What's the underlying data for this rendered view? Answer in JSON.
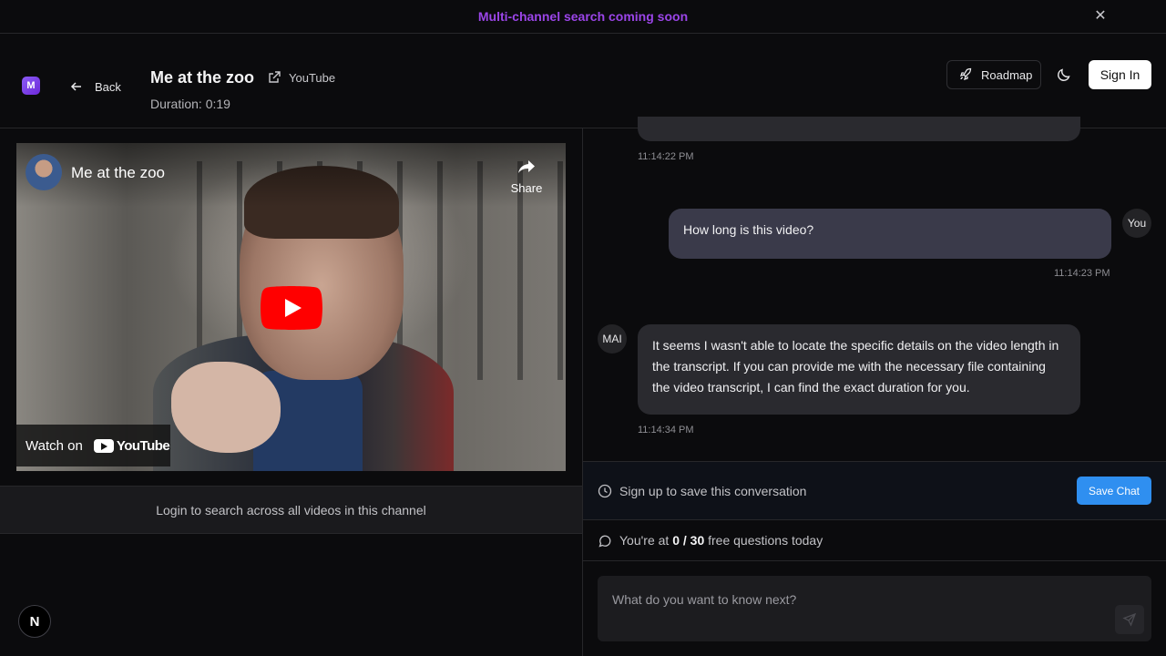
{
  "banner": {
    "text": "Multi-channel search coming soon",
    "close_icon": "close-icon"
  },
  "header": {
    "logo_letter": "M",
    "back_label": "Back",
    "video_title": "Me at the zoo",
    "source_label": "YouTube",
    "duration": "Duration: 0:19",
    "roadmap_label": "Roadmap",
    "signin_label": "Sign In"
  },
  "player": {
    "title": "Me at the zoo",
    "share_label": "Share",
    "watch_on_label": "Watch on",
    "yt_brand": "YouTube"
  },
  "login_bar": {
    "text": "Login to search across all videos in this channel"
  },
  "chat": {
    "messages": [
      {
        "role": "assistant",
        "text": "",
        "time": "11:14:22 PM"
      },
      {
        "role": "user",
        "avatar": "You",
        "text": "How long is this video?",
        "time": "11:14:23 PM"
      },
      {
        "role": "assistant",
        "avatar": "MAI",
        "text": "It seems I wasn't able to locate the specific details on the video length in the transcript. If you can provide me with the necessary file containing the video transcript, I can find the exact duration for you.",
        "time": "11:14:34 PM"
      }
    ]
  },
  "save_bar": {
    "text": "Sign up to save this conversation",
    "button_label": "Save Chat"
  },
  "quota": {
    "prefix": "You're at ",
    "count": "0 / 30",
    "suffix": " free questions today"
  },
  "composer": {
    "placeholder": "What do you want to know next?"
  },
  "misc": {
    "next_badge": "N"
  },
  "colors": {
    "accent_banner": "#9b45e8",
    "save_button": "#2f8ff0",
    "user_bubble": "#3a3a4a",
    "ai_bubble": "#2a2a2f"
  }
}
